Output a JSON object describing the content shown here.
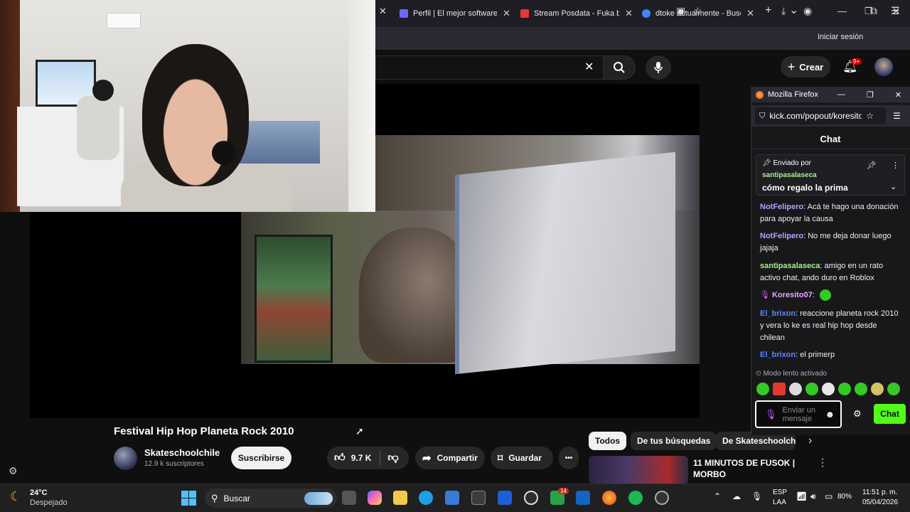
{
  "browser": {
    "tabs": [
      {
        "label": "Perfil | El mejor software par",
        "color": "#6a6aff"
      },
      {
        "label": "Stream Posdata - Fuka by el",
        "color": "#e53935"
      },
      {
        "label": "dtoke actualmente - Buscar",
        "color": "#4285f4"
      }
    ],
    "new_tab": "+",
    "tab_list": "⌄",
    "window_controls": {
      "minimize": "—",
      "maximize": "❐",
      "close": "✕"
    },
    "sign_in": "Iniciar sesión"
  },
  "youtube": {
    "create_label": "Crear",
    "notifications_badge": "9+",
    "video": {
      "title": "Festival Hip Hop Planeta Rock 2010",
      "channel": "Skateschoolchile",
      "subscribers": "12.9 k suscriptores",
      "subscribe_label": "Suscribirse",
      "likes": "9.7 K",
      "share_label": "Compartir",
      "save_label": "Guardar",
      "more_label": "•••"
    },
    "chips": [
      "Todos",
      "De tus búsquedas",
      "De Skateschoolchi"
    ],
    "recommendation": {
      "title": "11 MINUTOS DE FUSOK | MORBO",
      "menu": "⋮"
    }
  },
  "popout": {
    "window_title": "Mozilla Firefox",
    "url": "kick.com/popout/koresito",
    "chat_title": "Chat",
    "pinned": {
      "label": "Enviado por",
      "user": "santipasalaseca",
      "text": "cómo regalo la prima"
    },
    "messages": [
      {
        "user": "NotFelipero",
        "color": "#b9a0ff",
        "text": ": Acá te hago una donación para apoyar la causa"
      },
      {
        "user": "NotFelipero",
        "color": "#b9a0ff",
        "text": ": No me deja donar luego jajaja"
      },
      {
        "user": "santipasalaseca",
        "color": "#a6f08b",
        "text": ": amigo en un rato activo chat, ando duro en Roblox"
      },
      {
        "user": "Koresito07",
        "color": "#e7a8ff",
        "text": ":"
      },
      {
        "user": "El_brixon",
        "color": "#5f87ff",
        "text": ": reaccione planeta rock 2010 y vera lo ke es real hip hop desde chilean"
      },
      {
        "user": "El_brixon",
        "color": "#5f87ff",
        "text": ": el primerp"
      }
    ],
    "slow_mode": "Modo lento activado",
    "input_placeholder": "Enviar un mensaje",
    "send_label": "Chat"
  },
  "taskbar": {
    "weather_temp": "24°C",
    "weather_desc": "Despejado",
    "search_label": "Buscar",
    "language": "ESP",
    "layout": "LAA",
    "battery": "80%",
    "time": "11:51 p. m.",
    "date": "05/04/2026",
    "xbox_badge": "14"
  }
}
